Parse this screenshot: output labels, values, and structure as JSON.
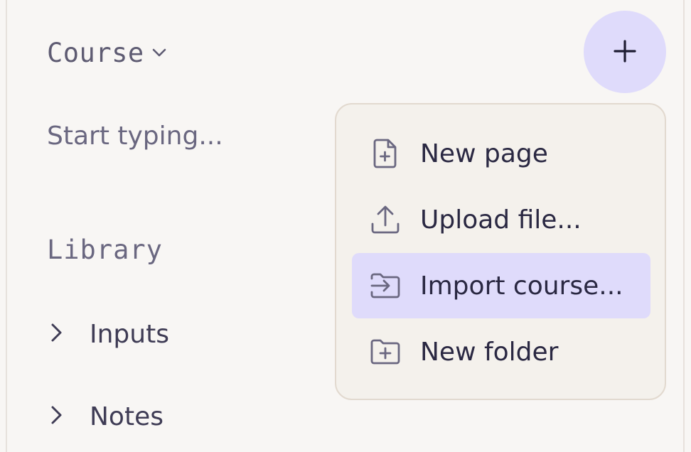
{
  "sidebar": {
    "course_label": "Course",
    "search_placeholder": "Start typing...",
    "library_heading": "Library",
    "tree_items": [
      {
        "label": "Inputs",
        "icon": "chevron-right-icon"
      },
      {
        "label": "Notes",
        "icon": "chevron-right-icon"
      }
    ]
  },
  "add_button": {
    "icon": "plus-icon"
  },
  "menu": {
    "active_index": 2,
    "items": [
      {
        "label": "New page",
        "icon": "file-plus-icon"
      },
      {
        "label": "Upload file...",
        "icon": "upload-icon"
      },
      {
        "label": "Import course...",
        "icon": "folder-import-icon"
      },
      {
        "label": "New folder",
        "icon": "folder-plus-icon"
      }
    ]
  },
  "colors": {
    "background": "#f8f6f4",
    "accent": "#dfdbfb",
    "menu_background": "#f4f1ec",
    "text_primary": "#2a2842",
    "text_muted": "#5e5b72"
  }
}
